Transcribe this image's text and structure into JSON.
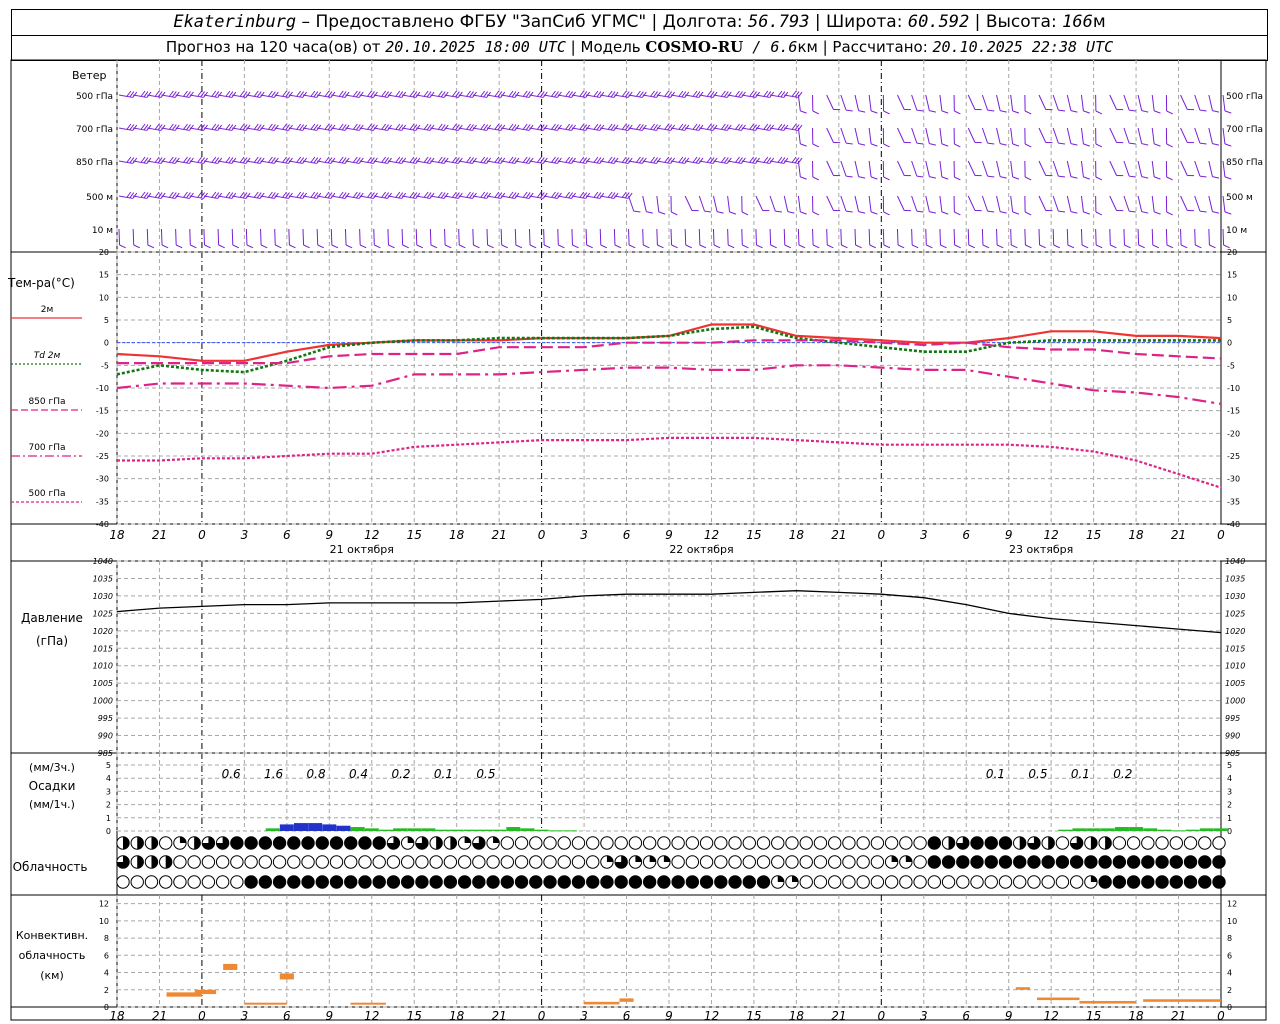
{
  "header": {
    "station": "Ekaterinburg",
    "provided_by": " – Предоставлено ФГБУ \"ЗапСиб УГМС\" | Долгота: ",
    "longitude": "56.793",
    "lat_label": " | Широта: ",
    "latitude": "60.592",
    "alt_label": " | Высота: ",
    "altitude": "166",
    "alt_unit": "м",
    "forecast_label": "Прогноз на 120 часа(ов) от ",
    "init_time": "20.10.2025 18:00 UTC",
    "model_label": " | Модель ",
    "model_name": "COSMO-RU",
    "model_res": " / 6.6",
    "res_unit": "км",
    "calc_label": " | Рассчитано: ",
    "calc_time": "20.10.2025 22:38 UTC"
  },
  "colors": {
    "wind": "#7a1fd6",
    "t2m": "#ee3333",
    "td2m": "#117711",
    "t850": "#dd2288",
    "t700": "#dd2288",
    "t500": "#dd2288",
    "pressure": "#000000",
    "precip_1h": "#22bb22",
    "precip_3h_high": "#2233cc",
    "conv": "#ee8833",
    "grid": "#a8a8a8",
    "zero_line": "#3355ff"
  },
  "axis": {
    "hour_labels": [
      "18",
      "21",
      "0",
      "3",
      "6",
      "9",
      "12",
      "15",
      "18",
      "21",
      "0",
      "3",
      "6",
      "9",
      "12",
      "15",
      "18",
      "21",
      "0",
      "3",
      "6",
      "9",
      "12",
      "15",
      "18",
      "21",
      "0"
    ],
    "day_labels": [
      "21 октября",
      "22 октября",
      "23 октября"
    ]
  },
  "wind_panel": {
    "title": "Ветер",
    "levels": [
      "500 гПа",
      "700 гПа",
      "850 гПа",
      "500 м",
      "10  м"
    ],
    "icon": "wind-barb-icon"
  },
  "temp_panel": {
    "title": "Тем-ра(°C)",
    "legend": [
      {
        "label": "2м",
        "style": "solid"
      },
      {
        "label": "Td  2м",
        "style": "dotted"
      },
      {
        "label": "850 гПа",
        "style": "dashed"
      },
      {
        "label": "700 гПа",
        "style": "dashdot"
      },
      {
        "label": "500 гПа",
        "style": "dotted-fine"
      }
    ]
  },
  "pressure_panel": {
    "title": "Давление",
    "unit": "(гПа)"
  },
  "precip_panel": {
    "unit_3h": "(мм/3ч.)",
    "title": "Осадки",
    "unit_1h": "(мм/1ч.)"
  },
  "cloud_panel": {
    "title": "Облачность",
    "icon": "cloud-cover-circle-icon"
  },
  "conv_panel": {
    "title1": "Конвективн.",
    "title2": "облачность",
    "unit": "(км)"
  },
  "chart_data": [
    {
      "type": "line",
      "title": "Тем-ра(°C)",
      "x_hours": [
        0,
        3,
        6,
        9,
        12,
        15,
        18,
        21,
        24,
        27,
        30,
        33,
        36,
        39,
        42,
        45,
        48,
        51,
        54,
        57,
        60,
        63,
        66,
        69,
        72,
        75,
        78
      ],
      "ylim": [
        -40,
        20
      ],
      "y_ticks": [
        -40,
        -35,
        -30,
        -25,
        -20,
        -15,
        -10,
        -5,
        0,
        5,
        10,
        15,
        20
      ],
      "series": [
        {
          "name": "2м",
          "values": [
            -2.5,
            -3,
            -4,
            -4,
            -2,
            -0.5,
            0,
            0.5,
            0.5,
            0.5,
            1,
            1,
            1,
            1.5,
            4,
            4,
            1.5,
            1,
            0.5,
            0,
            0,
            1,
            2.5,
            2.5,
            1.5,
            1.5,
            1
          ]
        },
        {
          "name": "Td  2м",
          "values": [
            -7,
            -5,
            -6,
            -6.5,
            -4,
            -1,
            0,
            0.5,
            0.5,
            1,
            1,
            1,
            1,
            1.5,
            3,
            3.5,
            1,
            0,
            -1,
            -2,
            -2,
            0,
            0.5,
            0.5,
            0.5,
            0.5,
            0.5
          ]
        },
        {
          "name": "850 гПа",
          "values": [
            -4.5,
            -4.5,
            -4.5,
            -4.5,
            -4.5,
            -3,
            -2.5,
            -2.5,
            -2.5,
            -1,
            -1,
            -1,
            0,
            0,
            0,
            0.5,
            0.5,
            0.5,
            0,
            -0.5,
            0,
            -1,
            -1.5,
            -1.5,
            -2.5,
            -3,
            -3.5
          ]
        },
        {
          "name": "700 гПа",
          "values": [
            -10,
            -9,
            -9,
            -9,
            -9.5,
            -10,
            -9.5,
            -7,
            -7,
            -7,
            -6.5,
            -6,
            -5.5,
            -5.5,
            -6,
            -6,
            -5,
            -5,
            -5.5,
            -6,
            -6,
            -7.5,
            -9,
            -10.5,
            -11,
            -12,
            -13.5
          ]
        },
        {
          "name": "500 гПа",
          "values": [
            -26,
            -26,
            -25.5,
            -25.5,
            -25,
            -24.5,
            -24.5,
            -23,
            -22.5,
            -22,
            -21.5,
            -21.5,
            -21.5,
            -21,
            -21,
            -21,
            -21.5,
            -22,
            -22.5,
            -22.5,
            -22.5,
            -22.5,
            -23,
            -24,
            -26,
            -29,
            -32
          ]
        }
      ]
    },
    {
      "type": "line",
      "title": "Давление",
      "ylabel": "(гПа)",
      "ylim": [
        985,
        1040
      ],
      "y_ticks": [
        985,
        990,
        995,
        1000,
        1005,
        1010,
        1015,
        1020,
        1025,
        1030,
        1035,
        1040
      ],
      "series": [
        {
          "name": "",
          "values": [
            1025.5,
            1026.5,
            1027,
            1027.5,
            1027.5,
            1028,
            1028,
            1028,
            1028,
            1028.5,
            1029,
            1030,
            1030.5,
            1030.5,
            1030.5,
            1031,
            1031.5,
            1031,
            1030.5,
            1029.5,
            1027.5,
            1025,
            1023.5,
            1022.5,
            1021.5,
            1020.5,
            1019.5
          ]
        }
      ]
    },
    {
      "type": "bar",
      "title": "Осадки",
      "ylim": [
        0,
        5
      ],
      "y_ticks": [
        0,
        1,
        2,
        3,
        4,
        5
      ],
      "labels_3h": [
        "0.6",
        "1.6",
        "0.8",
        "0.4",
        "0.2",
        "0.1",
        "0.5",
        "0.1",
        "0.5",
        "0.1",
        "0.2"
      ],
      "hours_1h": [
        11,
        12,
        13,
        14,
        15,
        16,
        17,
        18,
        19,
        20,
        21,
        22,
        23,
        24,
        25,
        26,
        27,
        28,
        29,
        30,
        31,
        32,
        33,
        34,
        35,
        36,
        37,
        38,
        39,
        40,
        41,
        42,
        43,
        44,
        45,
        46,
        47,
        48,
        49,
        50,
        51,
        52,
        53,
        54,
        55,
        56,
        57,
        58,
        59,
        60,
        61,
        62,
        63,
        64,
        65,
        66,
        67,
        68,
        69,
        70,
        71,
        72,
        73,
        74,
        75,
        76,
        77,
        78
      ],
      "values_1h": [
        0.2,
        0.5,
        0.6,
        0.6,
        0.5,
        0.4,
        0.3,
        0.2,
        0.1,
        0.2,
        0.2,
        0.2,
        0.1,
        0.1,
        0.1,
        0.1,
        0.1,
        0.3,
        0.2,
        0.1,
        0.05,
        0.05,
        0,
        0,
        0,
        0,
        0,
        0,
        0,
        0,
        0,
        0,
        0,
        0,
        0,
        0,
        0,
        0,
        0,
        0,
        0,
        0,
        0,
        0,
        0,
        0,
        0,
        0,
        0,
        0,
        0,
        0,
        0,
        0,
        0,
        0,
        0.1,
        0.2,
        0.2,
        0.2,
        0.3,
        0.3,
        0.2,
        0.1,
        0.05,
        0.1,
        0.2,
        0.2
      ]
    },
    {
      "type": "table",
      "title": "Облачность",
      "rows": [
        "high",
        "middle",
        "low"
      ],
      "cover_0_to_8": [
        [
          4,
          4,
          2,
          4,
          0,
          0,
          2,
          2,
          4,
          6,
          4,
          6,
          8,
          8,
          8,
          8,
          8,
          8,
          8,
          8,
          8,
          8,
          8,
          8,
          8,
          8,
          8,
          8,
          6,
          8,
          8,
          6,
          2,
          6,
          6,
          2,
          4,
          4,
          2,
          2,
          2,
          6,
          2,
          0,
          0,
          0,
          0,
          0,
          0,
          0,
          0,
          0,
          0,
          0,
          0,
          0,
          0,
          0,
          0,
          0,
          0,
          0,
          0,
          0,
          0,
          0,
          0,
          0,
          0,
          0,
          0,
          0,
          0,
          0,
          0,
          0,
          0,
          0,
          0,
          0,
          0,
          0,
          0,
          0,
          0,
          0,
          0,
          0,
          0,
          0,
          0,
          0,
          0,
          8,
          8,
          4,
          6,
          8,
          8,
          8,
          8,
          8,
          4,
          4,
          4,
          6,
          4,
          2,
          0,
          6,
          8,
          4,
          4,
          4,
          0,
          0,
          0,
          0,
          0,
          0,
          0,
          0,
          0,
          0,
          0,
          0,
          0,
          0
        ],
        [
          6,
          4,
          4,
          4,
          6,
          4,
          0,
          0,
          0,
          0,
          0,
          0,
          0,
          0,
          0,
          0,
          0,
          0,
          0,
          0,
          0,
          0,
          0,
          0,
          0,
          0,
          0,
          0,
          0,
          0,
          0,
          0,
          0,
          0,
          0,
          0,
          0,
          0,
          0,
          0,
          0,
          0,
          0,
          0,
          0,
          0,
          0,
          0,
          0,
          0,
          0,
          0,
          0,
          0,
          0,
          0,
          0,
          0,
          0,
          0,
          0,
          0,
          2,
          6,
          6,
          2,
          2,
          2,
          2,
          2,
          2,
          0,
          0,
          0,
          0,
          0,
          0,
          0,
          0,
          0,
          0,
          0,
          0,
          0,
          0,
          0,
          0,
          0,
          0,
          0,
          0,
          0,
          0,
          0,
          0,
          0,
          0,
          0,
          2,
          2,
          2,
          6,
          0,
          8,
          8,
          8,
          8,
          8,
          8,
          8,
          8,
          8,
          8,
          8,
          8,
          8,
          8,
          8,
          8,
          8,
          8,
          8,
          8,
          8,
          8,
          8,
          8,
          8,
          8,
          8,
          8,
          8,
          8,
          8,
          8,
          8,
          8,
          8,
          8,
          8,
          8,
          8,
          8
        ],
        [
          0,
          0,
          0,
          0,
          0,
          0,
          0,
          0,
          0,
          0,
          0,
          0,
          0,
          0,
          0,
          0,
          8,
          8,
          8,
          8,
          8,
          8,
          8,
          8,
          8,
          8,
          8,
          8,
          8,
          8,
          8,
          8,
          8,
          8,
          8,
          8,
          8,
          8,
          8,
          8,
          8,
          8,
          8,
          8,
          8,
          8,
          8,
          8,
          8,
          8,
          8,
          8,
          8,
          8,
          8,
          8,
          8,
          8,
          8,
          8,
          8,
          8,
          8,
          8,
          8,
          8,
          8,
          8,
          8,
          8,
          8,
          8,
          8,
          8,
          8,
          8,
          8,
          8,
          8,
          8,
          8,
          8,
          8,
          8,
          8,
          8,
          8,
          8,
          8,
          8,
          2,
          0,
          2,
          0,
          0,
          4,
          0,
          0,
          0,
          0,
          0,
          0,
          0,
          0,
          0,
          0,
          0,
          0,
          0,
          0,
          0,
          0,
          0,
          0,
          0,
          0,
          0,
          0,
          0,
          0,
          0,
          0,
          0,
          0,
          0,
          0,
          0,
          0,
          0,
          0,
          0,
          0,
          0,
          2,
          8,
          8,
          8,
          8,
          8,
          8,
          8,
          8,
          8,
          8,
          8,
          8,
          8,
          8,
          8,
          8,
          8,
          8,
          8
        ]
      ]
    },
    {
      "type": "bar",
      "title": "Конвективн. облачность",
      "ylabel": "(км)",
      "ylim": [
        0,
        13
      ],
      "y_ticks": [
        0,
        2,
        4,
        6,
        8,
        10,
        12
      ],
      "segments": [
        {
          "from_h": 3.5,
          "to_h": 6,
          "base": 1.2,
          "top": 1.7
        },
        {
          "from_h": 5.5,
          "to_h": 7,
          "base": 1.5,
          "top": 2.0
        },
        {
          "from_h": 7.5,
          "to_h": 8.5,
          "base": 4.3,
          "top": 5.0
        },
        {
          "from_h": 9,
          "to_h": 12,
          "base": 0.3,
          "top": 0.5
        },
        {
          "from_h": 11.5,
          "to_h": 12.5,
          "base": 3.2,
          "top": 3.9
        },
        {
          "from_h": 16.5,
          "to_h": 19,
          "base": 0.3,
          "top": 0.5
        },
        {
          "from_h": 33,
          "to_h": 35.5,
          "base": 0.3,
          "top": 0.6
        },
        {
          "from_h": 35.5,
          "to_h": 36.5,
          "base": 0.6,
          "top": 1.0
        },
        {
          "from_h": 63.5,
          "to_h": 64.5,
          "base": 2.0,
          "top": 2.3
        },
        {
          "from_h": 65,
          "to_h": 68,
          "base": 0.8,
          "top": 1.1
        },
        {
          "from_h": 68,
          "to_h": 72,
          "base": 0.4,
          "top": 0.7
        },
        {
          "from_h": 72.5,
          "to_h": 78,
          "base": 0.6,
          "top": 0.9
        }
      ]
    }
  ]
}
